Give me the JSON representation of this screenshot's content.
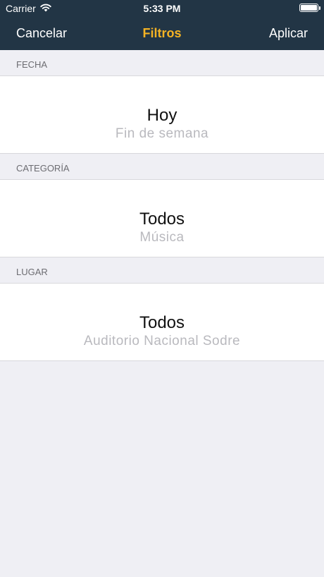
{
  "status_bar": {
    "carrier": "Carrier",
    "time": "5:33 PM"
  },
  "nav": {
    "cancel_label": "Cancelar",
    "title": "Filtros",
    "apply_label": "Aplicar"
  },
  "colors": {
    "nav_background": "#223545",
    "title_accent": "#F5B324",
    "page_background": "#EFEFF4"
  },
  "sections": [
    {
      "header": "FECHA",
      "selected": "Hoy",
      "next_option": "Fin de semana"
    },
    {
      "header": "CATEGORÍA",
      "selected": "Todos",
      "next_option": "Música"
    },
    {
      "header": "LUGAR",
      "selected": "Todos",
      "next_option": "Auditorio Nacional Sodre"
    }
  ]
}
